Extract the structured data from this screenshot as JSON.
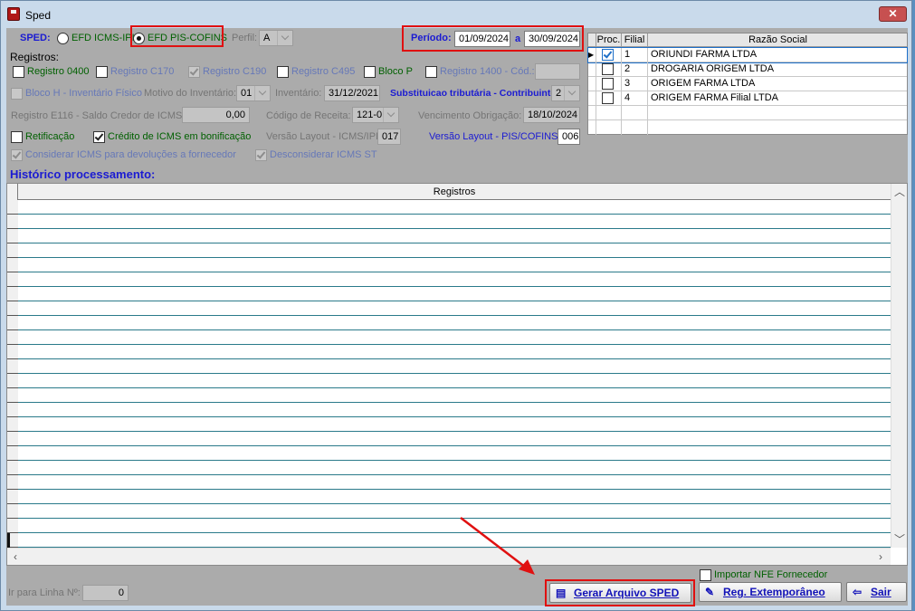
{
  "window": {
    "title": "Sped",
    "close_glyph": "✕"
  },
  "sped": {
    "label": "SPED:",
    "option_icms": "EFD ICMS-IPI",
    "option_pis": "EFD PIS-COFINS",
    "selected": "EFD PIS-COFINS",
    "perfil_label": "Perfil:",
    "perfil_value": "A"
  },
  "periodo": {
    "label": "Período:",
    "start": "01/09/2024",
    "sep": "a",
    "end": "30/09/2024"
  },
  "registros": {
    "title": "Registros:",
    "r0400": "Registro 0400",
    "rc170": "Registro C170",
    "rc190": "Registro C190",
    "rc495": "Registro C495",
    "blocop": "Bloco P",
    "r1400": "Registro 1400 - Cód.:",
    "blocoh": "Bloco H - Inventário Físico",
    "motivo_label": "Motivo do Inventário:",
    "motivo_value": "01",
    "inventario_label": "Inventário:",
    "inventario_value": "31/12/2021",
    "subst_label": "Substituicao tributária - Contribuinte:",
    "subst_value": "2",
    "e116_label": "Registro E116 - Saldo Credor de ICMS:",
    "e116_value": "0,00",
    "codreceita_label": "Código de Receita:",
    "codreceita_value": "121-0",
    "venc_label": "Vencimento Obrigação:",
    "venc_value": "18/10/2024",
    "retificacao": "Retificação",
    "credito": "Crédito de ICMS em bonificação",
    "versao_icms_label": "Versão Layout - ICMS/IPI:",
    "versao_icms_value": "017",
    "versao_pis_label": "Versão Layout - PIS/COFINS:",
    "versao_pis_value": "006",
    "considerar": "Considerar ICMS para devoluções a fornecedor",
    "desconsiderar": "Desconsiderar ICMS ST"
  },
  "companies": {
    "headers": [
      "Proc.",
      "Filial",
      "Razão Social"
    ],
    "rows": [
      {
        "proc": true,
        "filial": "1",
        "razao": "ORIUNDI FARMA LTDA"
      },
      {
        "proc": false,
        "filial": "2",
        "razao": "DROGARIA ORIGEM LTDA"
      },
      {
        "proc": false,
        "filial": "3",
        "razao": "ORIGEM FARMA LTDA"
      },
      {
        "proc": false,
        "filial": "4",
        "razao": "ORIGEM FARMA Filial LTDA"
      }
    ]
  },
  "historico": {
    "title": "Histórico processamento:",
    "column": "Registros"
  },
  "footer": {
    "ir_label": "Ir para Linha Nº:",
    "ir_value": "0",
    "importar": "Importar NFE Fornecedor",
    "gerar": "Gerar Arquivo SPED",
    "reg_ext": "Reg. Extemporâneo",
    "sair": "Sair"
  },
  "colors": {
    "highlight": "#e01010",
    "label_blue": "#1b1bd2",
    "label_green": "#006000"
  }
}
